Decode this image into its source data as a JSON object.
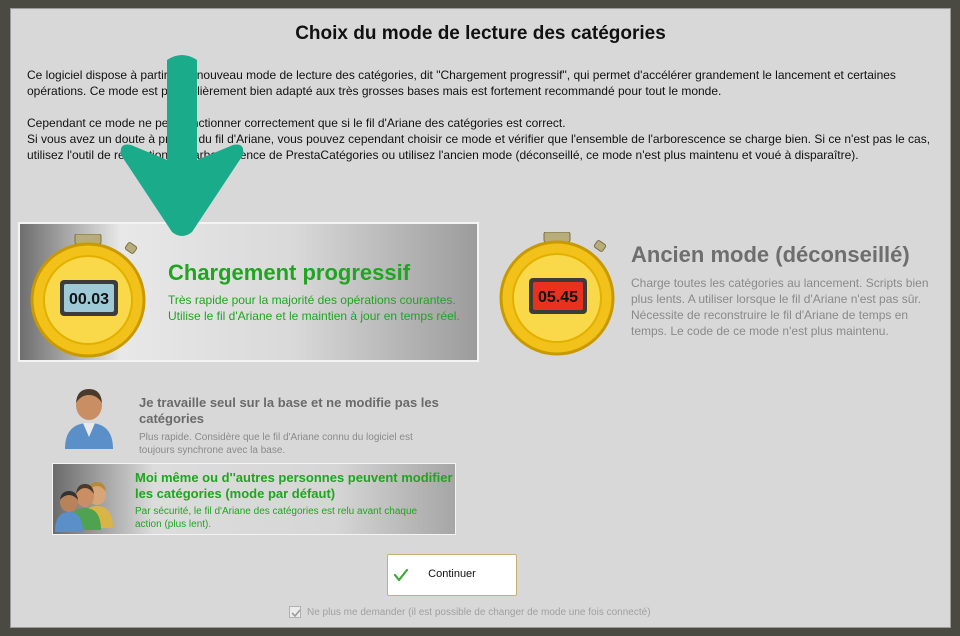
{
  "dialog": {
    "title": "Choix du mode de lecture des catégories",
    "intro": "Ce logiciel dispose à partir d'un nouveau mode de lecture des catégories, dit \"Chargement progressif\", qui permet d'accélérer grandement le lancement et certaines opérations. Ce mode est particulièrement bien adapté aux très grosses bases mais est fortement recommandé pour tout le monde.",
    "note_line1": "Cependant ce mode ne peut fonctionner correctement que si le fil d'Ariane des catégories est correct.",
    "note_line2": "Si vous avez un doute à propos du fil d'Ariane, vous pouvez cependant choisir ce mode et vérifier que l'ensemble de l'arborescence se charge bien. Si ce n'est pas le cas, utilisez l'outil de réparation de l'arborescence de PrestaCatégories ou utilisez l'ancien mode (déconseillé, ce mode n'est plus maintenu et voué à disparaître)."
  },
  "modes": {
    "progressive": {
      "title": "Chargement progressif",
      "description": "Très rapide pour la majorité des opérations courantes. Utilise le fil d'Ariane et le maintien à jour en temps réel.",
      "timer": "00.03",
      "selected": true
    },
    "legacy": {
      "title": "Ancien mode (déconseillé)",
      "description": "Charge toutes les catégories au lancement. Scripts bien plus lents. A utiliser lorsque le fil d'Ariane n'est pas sûr. Nécessite de reconstruire le fil d'Ariane de temps en temps. Le code de ce mode n'est plus maintenu.",
      "timer": "05.45",
      "selected": false
    }
  },
  "options": {
    "single": {
      "title": "Je travaille seul sur la base et ne modifie pas les catégories",
      "description": "Plus rapide. Considère que le fil d'Ariane connu du logiciel est toujours synchrone avec la base.",
      "selected": false
    },
    "multi": {
      "title": "Moi même ou d''autres personnes peuvent modifier les catégories (mode par défaut)",
      "description": "Par sécurité, le fil d'Ariane des catégories est relu avant chaque action (plus lent).",
      "selected": true
    }
  },
  "continue_label": "Continuer",
  "dont_ask": {
    "label": "Ne plus me demander (il est possible de changer de mode une fois connecté)",
    "checked": true
  },
  "colors": {
    "accent_green": "#1fa51f",
    "arrow_teal": "#1aab8a",
    "timer_blue": "#9ec9d6",
    "timer_red": "#e8321e"
  }
}
